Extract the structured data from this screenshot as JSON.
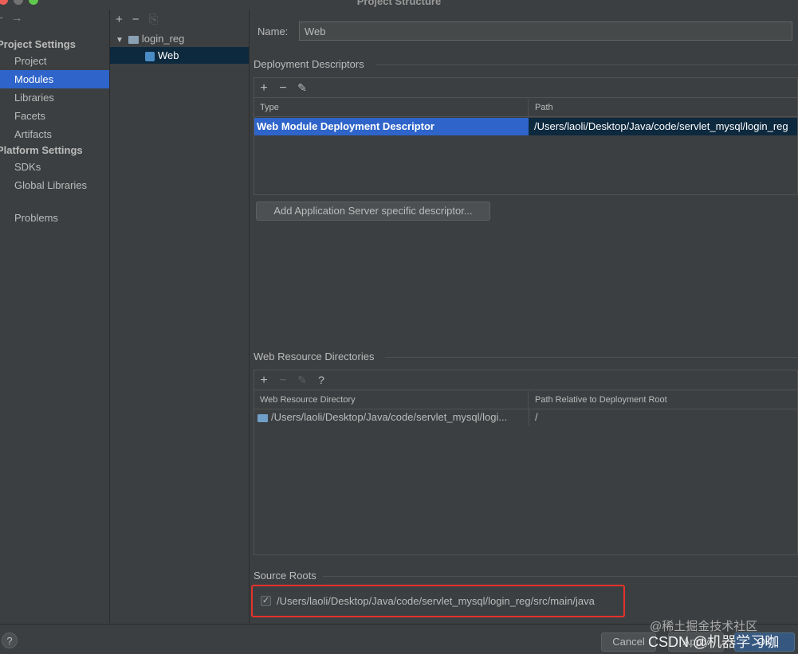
{
  "window": {
    "title": "Project Structure"
  },
  "colors": {
    "accent": "#2f65ca",
    "tree_selected": "#0d293e",
    "highlight": "#e5322c",
    "background": "#3c3f41"
  },
  "nav": {
    "back_icon": "minus-icon",
    "forward_icon": "arrow-right-icon",
    "project_settings_header": "Project Settings",
    "project_items": [
      "Project",
      "Modules",
      "Libraries",
      "Facets",
      "Artifacts"
    ],
    "platform_settings_header": "Platform Settings",
    "platform_items": [
      "SDKs",
      "Global Libraries"
    ],
    "problems": "Problems",
    "selected": "Modules"
  },
  "tree": {
    "toolbar": {
      "add": "+",
      "remove": "−",
      "copy_icon": "copy-icon"
    },
    "module": "login_reg",
    "facet": "Web"
  },
  "facet": {
    "name_label": "Name:",
    "name_value": "Web",
    "deployment": {
      "title": "Deployment Descriptors",
      "toolbar": {
        "add": "+",
        "remove": "−",
        "edit_icon": "pencil-icon"
      },
      "columns": [
        "Type",
        "Path"
      ],
      "rows": [
        {
          "type": "Web Module Deployment Descriptor",
          "path": "/Users/laoli/Desktop/Java/code/servlet_mysql/login_reg"
        }
      ],
      "add_server_button": "Add Application Server specific descriptor..."
    },
    "resources": {
      "title": "Web Resource Directories",
      "toolbar": {
        "add": "+",
        "remove": "−",
        "edit_icon": "pencil-icon",
        "help": "?"
      },
      "columns": [
        "Web Resource Directory",
        "Path Relative to Deployment Root"
      ],
      "rows": [
        {
          "directory": "/Users/laoli/Desktop/Java/code/servlet_mysql/logi...",
          "relative": "/"
        }
      ]
    },
    "source_roots": {
      "title": "Source Roots",
      "checked": true,
      "path": "/Users/laoli/Desktop/Java/code/servlet_mysql/login_reg/src/main/java"
    }
  },
  "footer": {
    "help": "?",
    "cancel": "Cancel",
    "apply": "Apply",
    "ok": "OK"
  },
  "watermark": {
    "line1": "@稀土掘金技术社区",
    "line2": "CSDN @机器学习咖"
  }
}
